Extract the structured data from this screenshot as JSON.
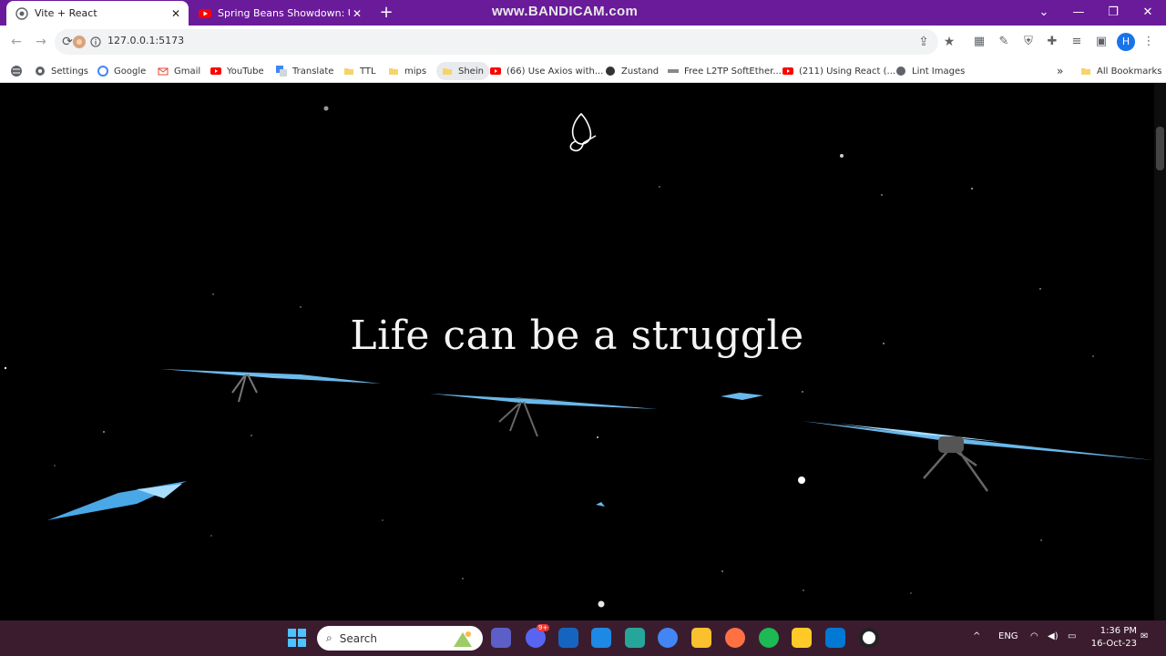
{
  "browser": {
    "tabs": [
      {
        "title": "Vite + React",
        "active": true
      },
      {
        "title": "Spring Beans Showdown: Unrave",
        "active": false
      }
    ],
    "new_tab_label": "+",
    "recording_watermark": "www.BANDICAM.com",
    "address": "127.0.0.1:5173",
    "bookmarks": [
      {
        "label": "Settings",
        "icon": "gear-icon"
      },
      {
        "label": "Google",
        "icon": "google-icon"
      },
      {
        "label": "Gmail",
        "icon": "gmail-icon"
      },
      {
        "label": "YouTube",
        "icon": "youtube-icon"
      },
      {
        "label": "Translate",
        "icon": "translate-icon"
      },
      {
        "label": "TTL",
        "icon": "folder-icon"
      },
      {
        "label": "mips",
        "icon": "folder-icon"
      },
      {
        "label": "Shein",
        "icon": "folder-icon"
      },
      {
        "label": "(66) Use Axios with...",
        "icon": "youtube-icon"
      },
      {
        "label": "Zustand",
        "icon": "github-icon"
      },
      {
        "label": "Free L2TP SoftEther...",
        "icon": "site-icon"
      },
      {
        "label": "(211) Using React (...",
        "icon": "youtube-icon"
      },
      {
        "label": "Lint Images",
        "icon": "globe-icon"
      }
    ],
    "overflow_label": "»",
    "all_bookmarks_label": "All Bookmarks",
    "profile_initial": "H"
  },
  "page": {
    "headline": "Life can be a struggle"
  },
  "taskbar": {
    "search_placeholder": "Search",
    "language": "ENG",
    "time": "1:36 PM",
    "date": "16-Oct-23",
    "discord_badge": "9+"
  },
  "colors": {
    "tab_strip": "#6a1b9a",
    "butterfly_blue": "#5bb8f5",
    "page_background": "#000000",
    "taskbar": "#3b1c2e"
  }
}
